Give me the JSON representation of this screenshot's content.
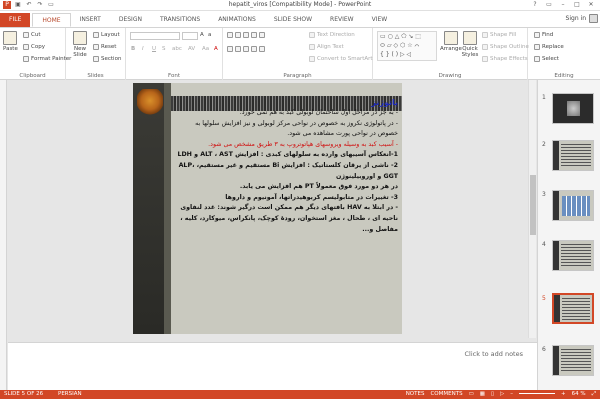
{
  "window": {
    "title": "hepatit_viros [Compatibility Mode] - PowerPoint",
    "sign_in": "Sign in"
  },
  "tabs": [
    "FILE",
    "HOME",
    "INSERT",
    "DESIGN",
    "TRANSITIONS",
    "ANIMATIONS",
    "SLIDE SHOW",
    "REVIEW",
    "VIEW"
  ],
  "ribbon": {
    "clipboard": {
      "paste": "Paste",
      "cut": "Cut",
      "copy": "Copy",
      "format_painter": "Format Painter",
      "label": "Clipboard"
    },
    "slides": {
      "new_slide": "New Slide",
      "layout": "Layout",
      "reset": "Reset",
      "section": "Section",
      "label": "Slides"
    },
    "font": {
      "label": "Font"
    },
    "paragraph": {
      "text_direction": "Text Direction",
      "align_text": "Align Text",
      "convert_smartart": "Convert to SmartArt",
      "label": "Paragraph"
    },
    "drawing": {
      "arrange": "Arrange",
      "quick_styles": "Quick Styles",
      "shape_fill": "Shape Fill",
      "shape_outline": "Shape Outline",
      "shape_effects": "Shape Effects",
      "label": "Drawing"
    },
    "editing": {
      "find": "Find",
      "replace": "Replace",
      "select": "Select",
      "label": "Editing"
    }
  },
  "slide": {
    "heading": "پاتوژنز",
    "lines": [
      "- به جز در مراحل اول ساختمان لوبولی کبد به هم نمی خورد.",
      "- در پاتولوژی نکروز به خصوص در نواحی مرکز لوبولی و نیز افزایش سلولها به خصوص در نواحی پورت مشاهده می شود.",
      "- آسیب کبد به وسیله ویروسهای هپاتوتروپ به ۳ طریق مشخص می شود.",
      "1-انعکاس آسیبهای وارده به سلولهای کبدی : افزایش ALT ، AST و LDH",
      "2- ناشی از یرقان کلستاتیک : افزایش Bi مستقیم و غیر مستقیم، ALP، GGT و اوروبیلینوژن",
      "در هر دو مورد فوق معمولاً PT هم افزایش می یابد.",
      "3- تغییرات در متابولیسم کربوهیدراتها، آمونیوم و داروها",
      "- در ابتلا به HAV بافتهای دیگر هم ممکن است درگیر شوند: غدد لنفاوی ناحیه ای ، طحال ، مغز استخوان، رودهٔ کوچک، پانکراس، میوکارد، کلیه ، مفاصل و..."
    ]
  },
  "notes_placeholder": "Click to add notes",
  "thumbnails": [
    "1",
    "2",
    "3",
    "4",
    "5",
    "6"
  ],
  "status": {
    "slide": "SLIDE 5 OF 26",
    "language": "PERSIAN",
    "notes": "NOTES",
    "comments": "COMMENTS",
    "zoom": "64 %"
  }
}
